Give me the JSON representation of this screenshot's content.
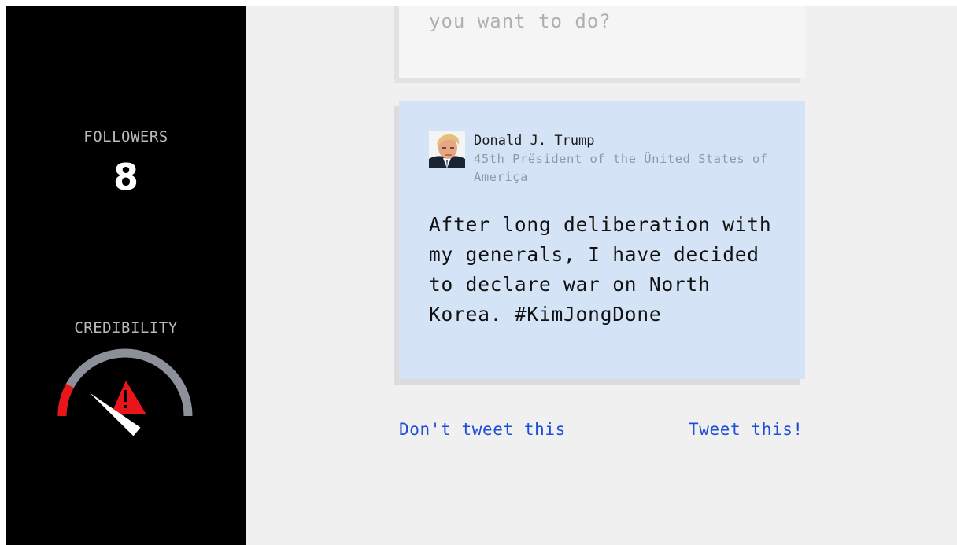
{
  "sidebar": {
    "followers_label": "FOLLOWERS",
    "followers_count": "8",
    "credibility_label": "CREDIBILITY",
    "credibility_gauge": {
      "level": 0.22,
      "warning_icon": "warning-triangle-icon",
      "colors": {
        "track": "#8c9199",
        "danger": "#e8161b",
        "needle": "#ffffff"
      }
    }
  },
  "prompt": {
    "text": "you want to do?"
  },
  "tweet": {
    "author_name": "Donald J. Trump",
    "author_title": "45th Prësident of the Ünited States of Ameriça",
    "text": "After long deliberation with my generals, I have decided to declare war on North Korea. #KimJongDone"
  },
  "actions": {
    "dont_tweet": "Don't tweet this",
    "tweet_this": "Tweet this!"
  },
  "colors": {
    "sidebar_bg": "#000000",
    "page_bg": "#f0f0f0",
    "tweet_bg": "#d4e3f5",
    "link": "#1f4fd6"
  }
}
